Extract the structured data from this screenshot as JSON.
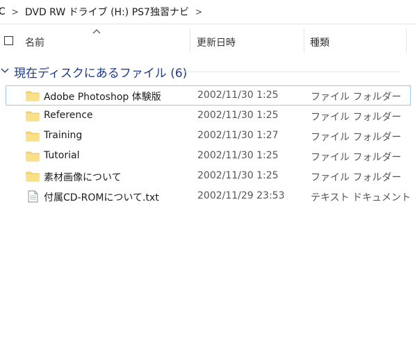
{
  "breadcrumb": {
    "items": [
      "C",
      "DVD RW ドライブ (H:) PS7独習ナビ"
    ],
    "separator": ">"
  },
  "columns": {
    "name": "名前",
    "date": "更新日時",
    "type": "種類"
  },
  "group": {
    "label": "現在ディスクにあるファイル (6)"
  },
  "files": [
    {
      "name": "Adobe Photoshop 体験版",
      "date": "2002/11/30 1:25",
      "type": "ファイル フォルダー",
      "icon": "folder-icon"
    },
    {
      "name": "Reference",
      "date": "2002/11/30 1:25",
      "type": "ファイル フォルダー",
      "icon": "folder-icon"
    },
    {
      "name": "Training",
      "date": "2002/11/30 1:27",
      "type": "ファイル フォルダー",
      "icon": "folder-icon"
    },
    {
      "name": "Tutorial",
      "date": "2002/11/30 1:25",
      "type": "ファイル フォルダー",
      "icon": "folder-icon"
    },
    {
      "name": "素材画像について",
      "date": "2002/11/30 1:25",
      "type": "ファイル フォルダー",
      "icon": "folder-icon"
    },
    {
      "name": "付属CD-ROMについて.txt",
      "date": "2002/11/29 23:53",
      "type": "テキスト ドキュメント",
      "icon": "text-document-icon"
    }
  ],
  "colors": {
    "group_label": "#1f3c88",
    "selection_border": "#99c9ef",
    "folder": "#f8d775"
  }
}
